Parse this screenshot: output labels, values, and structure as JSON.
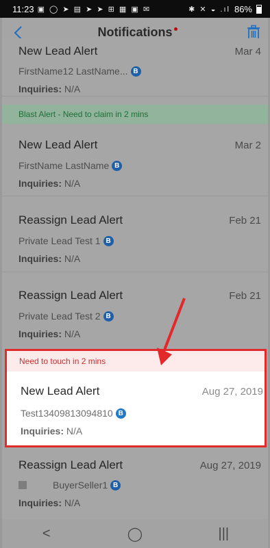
{
  "status_bar": {
    "time": "11:23",
    "icons": "▣ ◯ ➤ ▤ ➤ ➤ ⊞ ▦ ▣ ✉",
    "right_icons": "✱ ✕ ◒ .ıl",
    "battery": "86%"
  },
  "header": {
    "title": "Notifications"
  },
  "notifications": [
    {
      "title": "New Lead Alert",
      "date": "Mar 4",
      "name": "FirstName12 LastName...",
      "badge": "B",
      "inquiries_label": "Inquiries:",
      "inquiries_value": "N/A"
    },
    {
      "banner": "Blast Alert - Need to claim in 2 mins",
      "title": "New Lead Alert",
      "date": "Mar 2",
      "name": "FirstName LastName",
      "badge": "B",
      "inquiries_label": "Inquiries:",
      "inquiries_value": "N/A"
    },
    {
      "title": "Reassign Lead Alert",
      "date": "Feb 21",
      "name": "Private Lead Test 1",
      "badge": "B",
      "inquiries_label": "Inquiries:",
      "inquiries_value": "N/A"
    },
    {
      "title": "Reassign Lead Alert",
      "date": "Feb 21",
      "name": "Private Lead Test 2",
      "badge": "B",
      "inquiries_label": "Inquiries:",
      "inquiries_value": "N/A"
    },
    {
      "banner": "Need to touch in 2 mins",
      "title": "New Lead Alert",
      "date": "Aug 27, 2019",
      "name": "Test13409813094810",
      "badge": "B",
      "inquiries_label": "Inquiries:",
      "inquiries_value": "N/A"
    },
    {
      "title": "Reassign Lead Alert",
      "date": "Aug 27, 2019",
      "name": "BuyerSeller1",
      "badge": "B",
      "inquiries_label": "Inquiries:",
      "inquiries_value": "N/A"
    }
  ],
  "nav": {
    "back": "<",
    "home": "◯",
    "recents": "|||"
  },
  "colors": {
    "accent": "#1f7ac8",
    "highlight_border": "#e12a2a",
    "blast_banner_text": "#1e6e39",
    "touch_banner_text": "#c82f2f"
  }
}
